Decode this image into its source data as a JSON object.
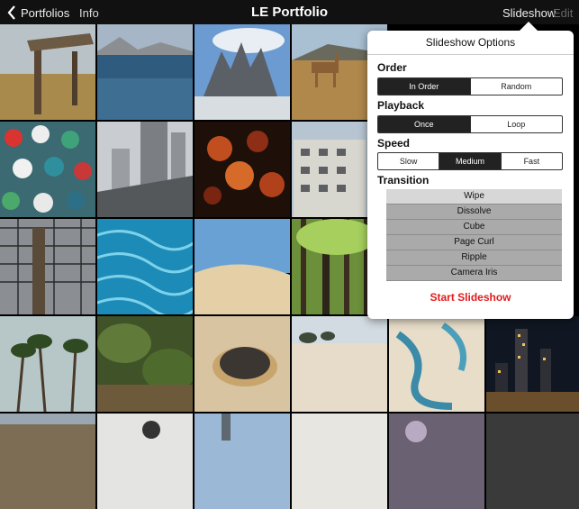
{
  "nav": {
    "back_label": "Portfolios",
    "info_label": "Info",
    "title": "LE Portfolio",
    "slideshow_label": "Slideshow",
    "edit_label": "Edit"
  },
  "popover": {
    "title": "Slideshow Options",
    "order": {
      "label": "Order",
      "options": [
        "In Order",
        "Random"
      ],
      "selected": "In Order"
    },
    "playback": {
      "label": "Playback",
      "options": [
        "Once",
        "Loop"
      ],
      "selected": "Once"
    },
    "speed": {
      "label": "Speed",
      "options": [
        "Slow",
        "Medium",
        "Fast"
      ],
      "selected": "Medium"
    },
    "transition": {
      "label": "Transition",
      "options": [
        "Wipe",
        "Dissolve",
        "Cube",
        "Page Curl",
        "Ripple",
        "Camera Iris"
      ],
      "selected": "Wipe"
    },
    "start_label": "Start Slideshow"
  },
  "photos": [
    "wooden-signpost-field",
    "lake-mountains",
    "rocky-peaks-clouds",
    "guanaco-hills",
    "",
    "",
    "toy-figures-crowd",
    "city-highway-buildings",
    "bokeh-lights",
    "apartment-building",
    "",
    "",
    "fence-pole",
    "blue-water-ripples",
    "desert-dune",
    "forest-trees",
    "",
    "",
    "palm-trees",
    "jungle-foliage",
    "rock-on-sand",
    "sandy-beach-trees",
    "lagoons-dunes",
    "city-night"
  ],
  "colors": {
    "accent_red": "#e21b1b",
    "bar_bg": "#111111"
  }
}
